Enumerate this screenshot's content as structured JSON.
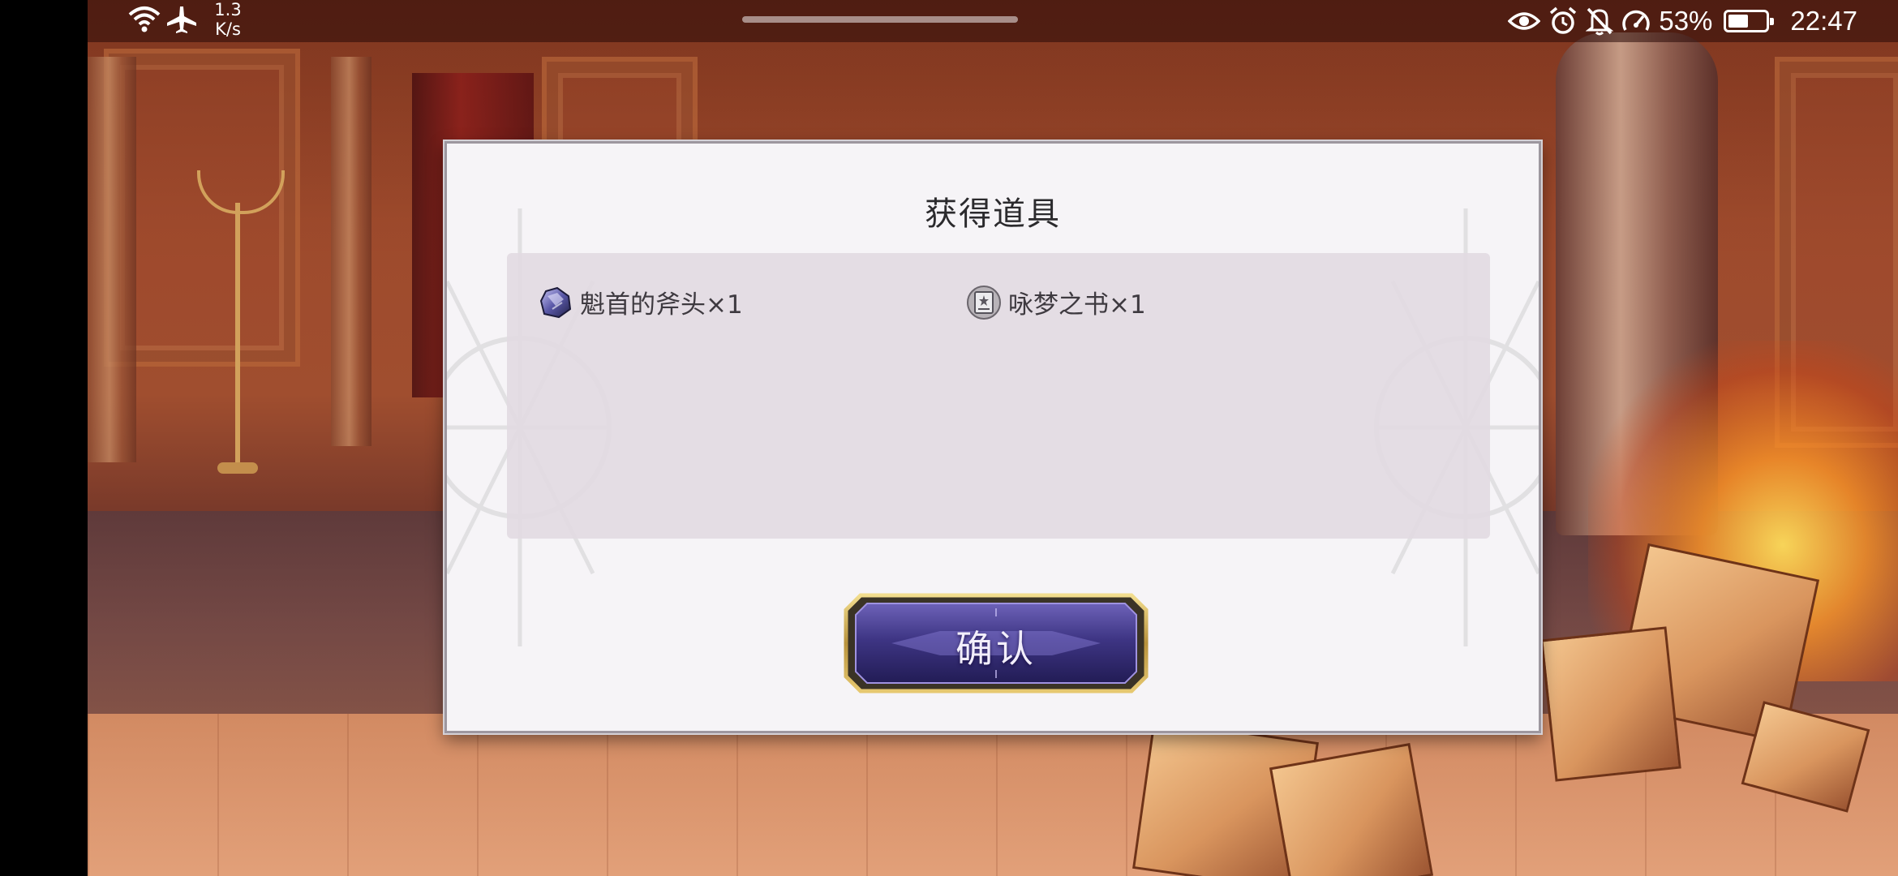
{
  "status_bar": {
    "net_speed_value": "1.3",
    "net_speed_unit": "K/s",
    "battery_percent": "53%",
    "battery_level": 0.53,
    "clock": "22:47",
    "icons": [
      "wifi-icon",
      "airplane-mode-icon",
      "eye-comfort-icon",
      "alarm-icon",
      "bell-muted-icon",
      "speed-meter-icon",
      "battery-icon"
    ]
  },
  "dialog": {
    "title": "获得道具",
    "items": [
      {
        "name": "魁首的斧头×1",
        "icon": "crystal-axe-icon"
      },
      {
        "name": "咏梦之书×1",
        "icon": "dream-book-icon"
      }
    ],
    "confirm_label": "确认"
  },
  "colors": {
    "dialog_bg": "#f6f4f7",
    "item_panel_bg": "#e2dae2",
    "button_purple": "#4a3f8e",
    "button_gold_border": "#c9a84e"
  }
}
